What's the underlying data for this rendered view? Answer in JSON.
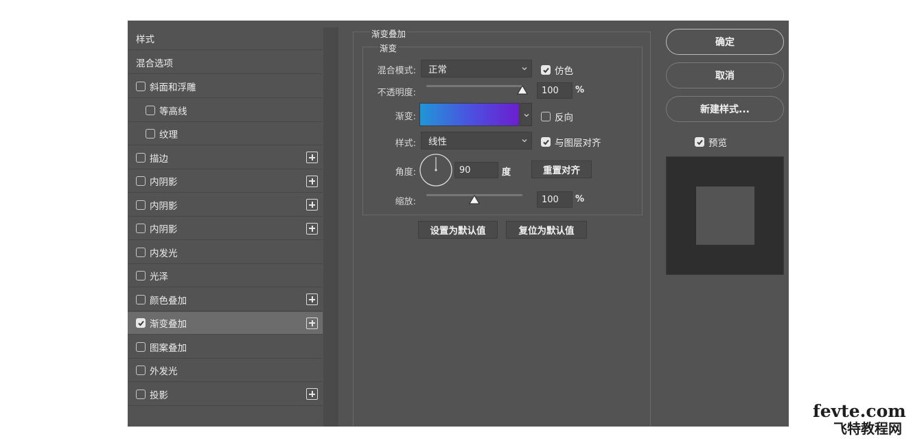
{
  "style_list": {
    "header": "样式",
    "blend_options": "混合选项",
    "items": [
      {
        "label": "斜面和浮雕",
        "checked": false,
        "indent": false,
        "plus": false
      },
      {
        "label": "等高线",
        "checked": false,
        "indent": true,
        "plus": false
      },
      {
        "label": "纹理",
        "checked": false,
        "indent": true,
        "plus": false
      },
      {
        "label": "描边",
        "checked": false,
        "indent": false,
        "plus": true
      },
      {
        "label": "内阴影",
        "checked": false,
        "indent": false,
        "plus": true
      },
      {
        "label": "内阴影",
        "checked": false,
        "indent": false,
        "plus": true
      },
      {
        "label": "内阴影",
        "checked": false,
        "indent": false,
        "plus": true
      },
      {
        "label": "内发光",
        "checked": false,
        "indent": false,
        "plus": false
      },
      {
        "label": "光泽",
        "checked": false,
        "indent": false,
        "plus": false
      },
      {
        "label": "颜色叠加",
        "checked": false,
        "indent": false,
        "plus": true
      },
      {
        "label": "渐变叠加",
        "checked": true,
        "indent": false,
        "plus": true,
        "selected": true
      },
      {
        "label": "图案叠加",
        "checked": false,
        "indent": false,
        "plus": false
      },
      {
        "label": "外发光",
        "checked": false,
        "indent": false,
        "plus": false
      },
      {
        "label": "投影",
        "checked": false,
        "indent": false,
        "plus": true
      }
    ]
  },
  "gradient_overlay": {
    "title": "渐变叠加",
    "group": "渐变",
    "blend_mode_label": "混合模式:",
    "blend_mode_value": "正常",
    "dither_label": "仿色",
    "dither_checked": true,
    "opacity_label": "不透明度:",
    "opacity_value": "100",
    "opacity_fraction": 1.0,
    "percent": "%",
    "gradient_label": "渐变:",
    "gradient_colors": [
      "#2196d6",
      "#4a52e0",
      "#6b1fcf"
    ],
    "reverse_label": "反向",
    "reverse_checked": false,
    "style_label": "样式:",
    "style_value": "线性",
    "align_label": "与图层对齐",
    "align_checked": true,
    "angle_label": "角度:",
    "angle_value": "90",
    "angle_unit": "度",
    "reset_alignment": "重置对齐",
    "scale_label": "缩放:",
    "scale_value": "100",
    "scale_fraction": 0.5,
    "set_default": "设置为默认值",
    "reset_default": "复位为默认值"
  },
  "actions": {
    "ok": "确定",
    "cancel": "取消",
    "new_style": "新建样式...",
    "preview_label": "预览",
    "preview_checked": true
  },
  "colors": {
    "dialog_bg": "#535353",
    "selected_row": "#6c6c6c",
    "preview_outer": "#2e2e2e",
    "preview_inner": "#545454"
  },
  "watermark": {
    "line1": "fevte.com",
    "line2": "飞特教程网"
  }
}
